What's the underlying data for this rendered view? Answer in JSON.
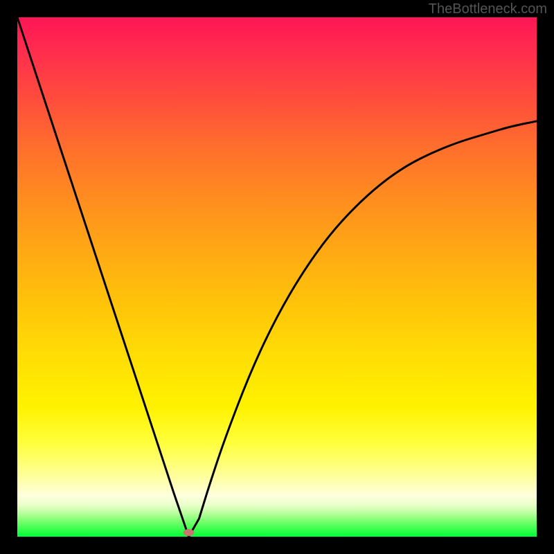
{
  "watermark": "TheBottleneck.com",
  "chart_data": {
    "type": "line",
    "title": "",
    "xlabel": "",
    "ylabel": "",
    "x": [
      0,
      5,
      10,
      15,
      20,
      25,
      30,
      33,
      35,
      37,
      40,
      45,
      50,
      55,
      60,
      65,
      70,
      75,
      80,
      85,
      90,
      95,
      100
    ],
    "values": [
      100,
      84.8,
      69.6,
      54.4,
      39.2,
      24.0,
      8.8,
      0,
      3.5,
      10.0,
      19.0,
      32.0,
      42.5,
      51.0,
      58.0,
      63.5,
      68.0,
      71.5,
      74.0,
      76.0,
      77.5,
      79.0,
      80.0
    ],
    "xlim": [
      0,
      100
    ],
    "ylim": [
      0,
      100
    ],
    "minimum_point": {
      "x": 33,
      "y": 0
    },
    "marker": {
      "x": 33,
      "y": 0.8
    }
  }
}
